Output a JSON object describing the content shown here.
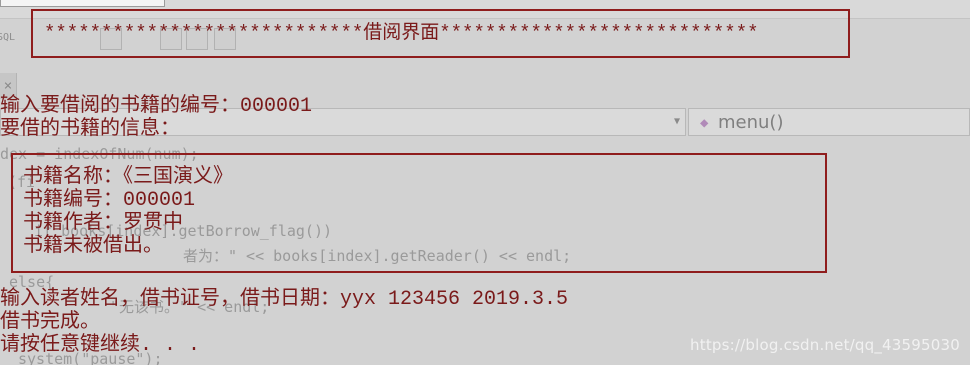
{
  "background_ide": {
    "combo_right_label": "menu()",
    "code_lines": [
      "dex = indexOfNum(num);",
      "(fi",
      "if books[index].getBorrow_flag())",
      "者为：\" << books[index].getReader() << endl;",
      "else{",
      "\"无该书。\" << endl;",
      "system(\"pause\");"
    ]
  },
  "console": {
    "title": "****************************借阅界面****************************",
    "prompt_book_id": "输入要借阅的书籍的编号：000001",
    "book_info_header": "要借的书籍的信息：",
    "book": {
      "name_line": "书籍名称：《三国演义》",
      "id_line": "书籍编号：000001",
      "author_line": "书籍作者：罗贯中",
      "status_line": "书籍未被借出。"
    },
    "prompt_reader": "输入读者姓名，借书证号，借书日期：yyx 123456 2019.3.5",
    "done_message": "借书完成。",
    "continue_prompt": "请按任意键继续. . ."
  },
  "watermark": "https://blog.csdn.net/qq_43595030",
  "colors": {
    "console_text": "#7a1a1a",
    "box_border": "#8f1d1d",
    "background": "#d2d2d2"
  }
}
